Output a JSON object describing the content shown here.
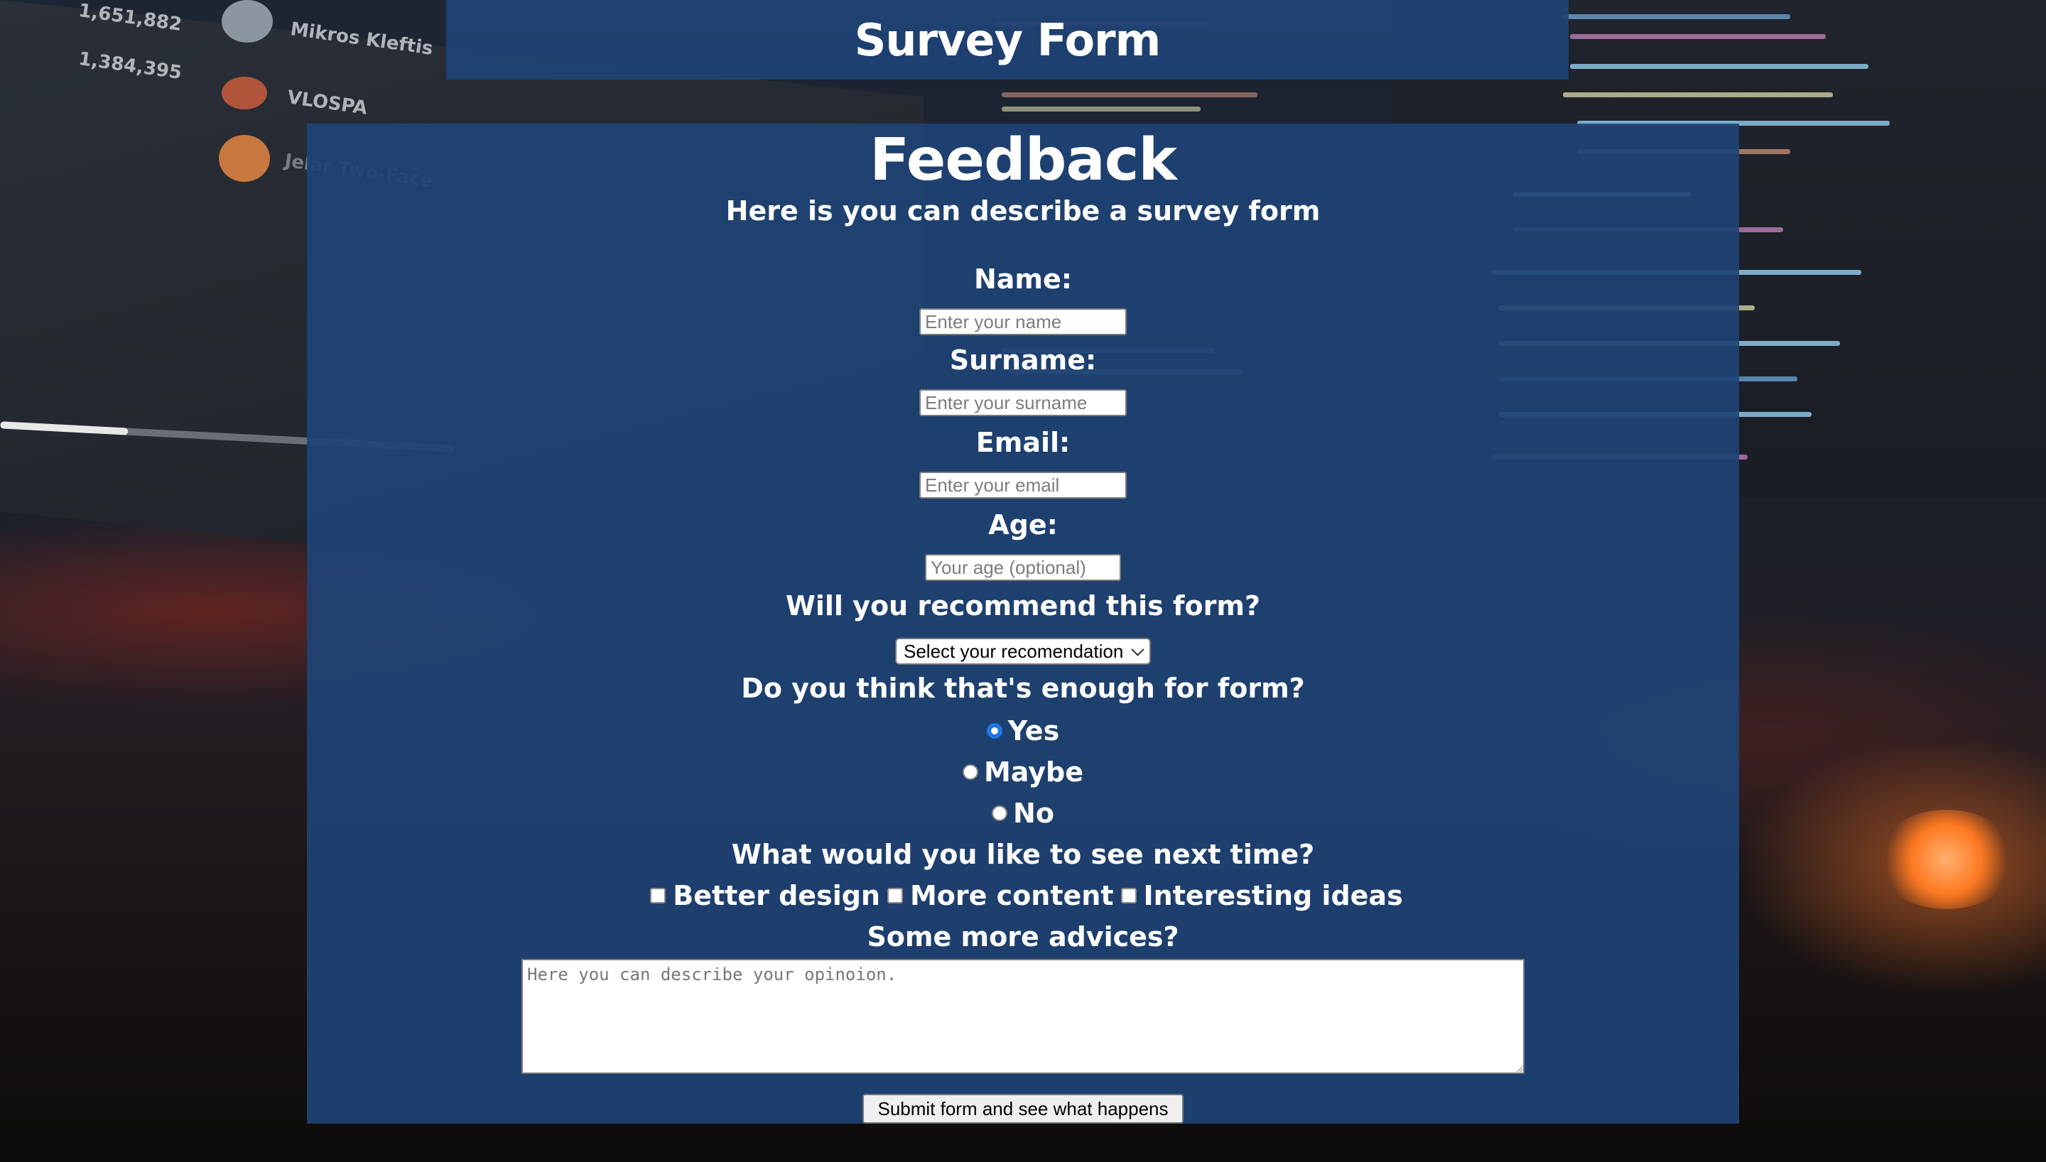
{
  "header": {
    "title": "Survey Form"
  },
  "form": {
    "title": "Feedback",
    "description": "Here is you can describe a survey form",
    "fields": {
      "name": {
        "label": "Name:",
        "placeholder": "Enter your name"
      },
      "surname": {
        "label": "Surname:",
        "placeholder": "Enter your surname"
      },
      "email": {
        "label": "Email:",
        "placeholder": "Enter your email"
      },
      "age": {
        "label": "Age:",
        "placeholder": "Your age (optional)"
      }
    },
    "recommend": {
      "label": "Will you recommend this form?",
      "selected": "Select your recomendation"
    },
    "enough": {
      "label": "Do you think that's enough for form?",
      "options": [
        "Yes",
        "Maybe",
        "No"
      ],
      "selected": "Yes"
    },
    "next_time": {
      "label": "What would you like to see next time?",
      "options": [
        "Better design",
        "More content",
        "Interesting ideas"
      ]
    },
    "advices": {
      "label": "Some more advices?",
      "placeholder": "Here you can describe your opinoion."
    },
    "submit_label": "Submit form and see what happens"
  },
  "background": {
    "stats": [
      "1,651,882",
      "1,384,395"
    ],
    "names": [
      "Mikros Kleftis",
      "VLOSPA",
      "Jelar Two-Face"
    ]
  },
  "colors": {
    "panel": "#1e4375",
    "accent": "#1a73e8",
    "text": "#ffffff"
  }
}
